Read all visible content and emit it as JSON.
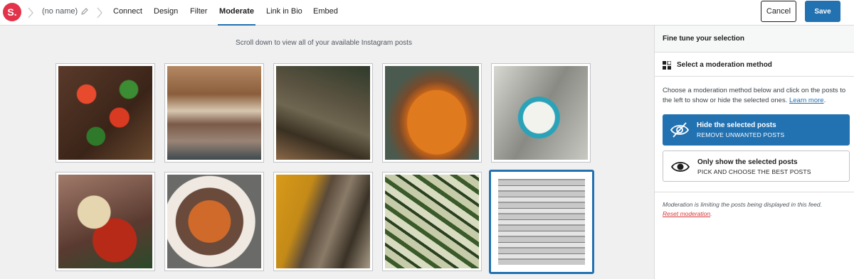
{
  "header": {
    "logo_text": "S.",
    "feed_name": "(no name)",
    "tabs": [
      {
        "label": "Connect"
      },
      {
        "label": "Design"
      },
      {
        "label": "Filter"
      },
      {
        "label": "Moderate",
        "active": true
      },
      {
        "label": "Link in Bio"
      },
      {
        "label": "Embed"
      }
    ],
    "cancel_label": "Cancel",
    "save_label": "Save"
  },
  "main": {
    "hint": "Scroll down to view all of your available Instagram posts",
    "posts": [
      {
        "name": "post-tomato-pepper-stirfry"
      },
      {
        "name": "post-parfait-jar"
      },
      {
        "name": "post-bread-loaf"
      },
      {
        "name": "post-baked-bars-pan"
      },
      {
        "name": "post-baking-soda-spoon"
      },
      {
        "name": "post-salsa-chip"
      },
      {
        "name": "post-sweet-potato-bowl"
      },
      {
        "name": "post-turmeric-spices"
      },
      {
        "name": "post-zucchini"
      },
      {
        "name": "post-glass-jar",
        "selected": true
      }
    ]
  },
  "sidebar": {
    "title": "Fine tune your selection",
    "method_label": "Select a moderation method",
    "description": "Choose a moderation method below and click on the posts to the left to show or hide the selected ones.",
    "learn_more": "Learn more",
    "options": [
      {
        "title": "Hide the selected posts",
        "subtitle": "REMOVE UNWANTED POSTS",
        "icon": "eye-slash-icon",
        "active": true
      },
      {
        "title": "Only show the selected posts",
        "subtitle": "PICK AND CHOOSE THE BEST POSTS",
        "icon": "eye-icon",
        "active": false
      }
    ],
    "note": "Moderation is limiting the posts being displayed in this feed.",
    "reset_label": "Reset moderation"
  },
  "colors": {
    "accent": "#2271b1",
    "brand": "#e3334a",
    "danger": "#d63638"
  }
}
